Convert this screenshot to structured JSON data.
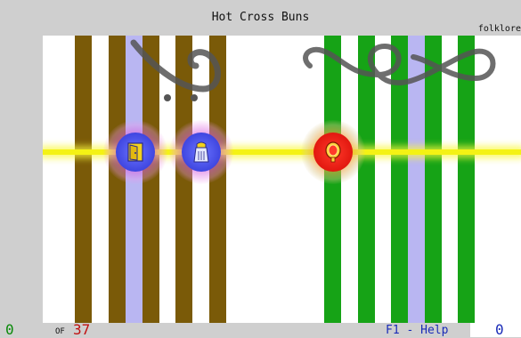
{
  "song_title": "Hot Cross Buns",
  "genre": "folklore",
  "footer": {
    "left_score": "0",
    "of_label": "OF",
    "total": "37",
    "help": "F1 - Help",
    "right_score": "0"
  },
  "notes": [
    {
      "color": "blue",
      "icon": "door-icon"
    },
    {
      "color": "blue",
      "icon": "salt-shaker-icon"
    },
    {
      "color": "red",
      "icon": "mirror-icon"
    }
  ],
  "colors": {
    "background": "#cfcfcf",
    "brown_lane": "#7a5a08",
    "green_lane": "#16a316",
    "lavender_lane": "#b9b6f2",
    "beam": "#f4f214",
    "note_blue": "#3f46e0",
    "note_red": "#e0160e",
    "score_green": "#0a8a0a",
    "total_red": "#c01010",
    "help_blue": "#1a2cb8"
  }
}
